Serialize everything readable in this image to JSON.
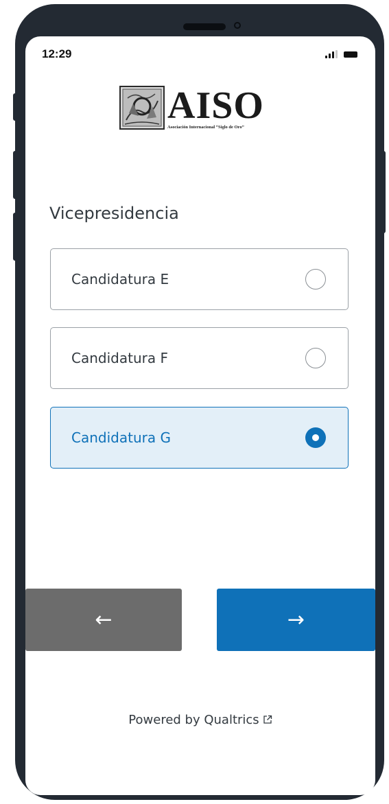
{
  "status_bar": {
    "time": "12:29",
    "signal_icon": "signal-icon",
    "battery_icon": "battery-icon"
  },
  "header": {
    "logo_word": "AISO",
    "logo_subtitle": "Asociación Internacional “Siglo de Oro”",
    "logo_icon": "emblem-icon"
  },
  "question": {
    "title": "Vicepresidencia",
    "options": [
      {
        "label": "Candidatura E",
        "selected": false
      },
      {
        "label": "Candidatura F",
        "selected": false
      },
      {
        "label": "Candidatura G",
        "selected": true
      }
    ]
  },
  "navigation": {
    "back_label": "←",
    "next_label": "→"
  },
  "footer": {
    "text": "Powered by Qualtrics",
    "external_icon": "external-link-icon"
  },
  "colors": {
    "accent": "#0f71b8",
    "selected_bg": "#e3eff8",
    "back_button": "#6c6c6c",
    "phone_frame": "#232a33"
  }
}
